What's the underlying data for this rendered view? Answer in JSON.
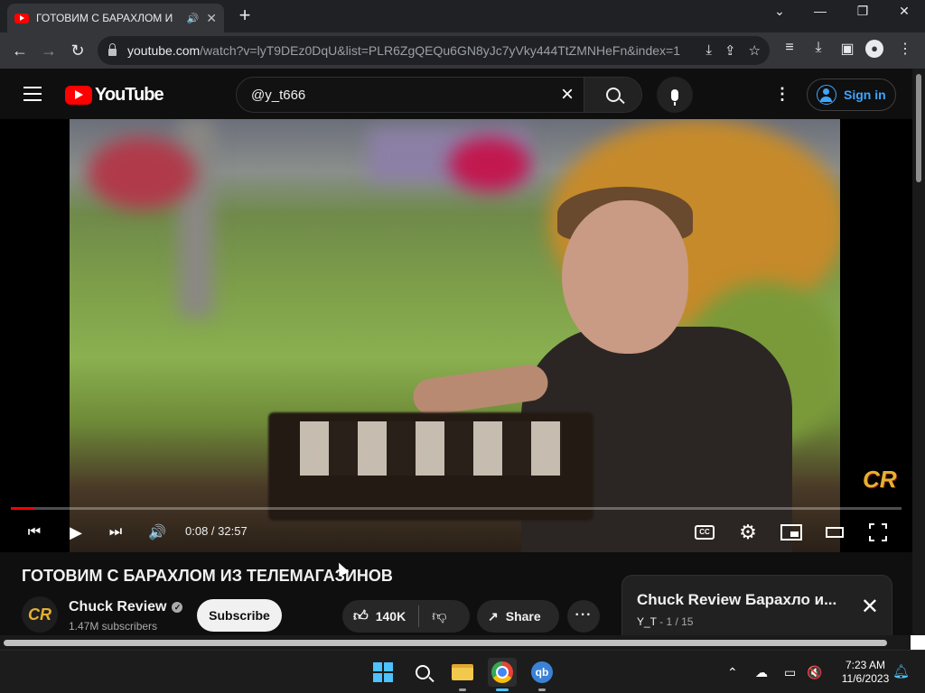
{
  "browser": {
    "tab": {
      "title": "ГОТОВИМ С БАРАХЛОМ И",
      "audio_icon": "speaker-icon",
      "close_glyph": "✕"
    },
    "new_tab_glyph": "+",
    "window_controls": {
      "tab_search": "⌄",
      "minimize": "—",
      "restore": "❐",
      "close": "✕"
    },
    "url": {
      "host": "youtube.com",
      "path": "/watch?v=lyT9DEz0DqU&list=PLR6ZgQEQu6GN8yJc7yVky444TtZMNHeFn&index=1"
    },
    "toolbar_icons": [
      "back-icon",
      "forward-icon",
      "reload-icon",
      "install-icon",
      "share-icon",
      "bookmark-star-icon",
      "media-icon",
      "downloads-icon",
      "sidebar-icon",
      "profile-icon",
      "menu-icon"
    ]
  },
  "youtube": {
    "logo_text": "YouTube",
    "search": {
      "value": "@y_t666",
      "placeholder": "Search"
    },
    "sign_in_label": "Sign in"
  },
  "player": {
    "time": "0:08 / 32:57",
    "progress_fraction": 0.004,
    "watermark": "CR",
    "cc_label": "CC"
  },
  "video": {
    "title": "ГОТОВИМ С БАРАХЛОМ ИЗ ТЕЛЕМАГАЗИНОВ",
    "channel": {
      "name": "Chuck Review",
      "subscribers": "1.47M subscribers",
      "avatar_text": "CR"
    },
    "subscribe_label": "Subscribe",
    "likes": "140K",
    "share_label": "Share",
    "more_glyph": "···"
  },
  "playlist": {
    "title": "Chuck Review Барахло и...",
    "owner": "Y_T",
    "position": " - 1 / 15"
  },
  "taskbar": {
    "clock_time": "7:23 AM",
    "clock_date": "11/6/2023",
    "qb_label": "qb"
  },
  "colors": {
    "accent_red": "#ff0000",
    "link_blue": "#3ea6ff",
    "page_bg": "#0f0f0f"
  }
}
